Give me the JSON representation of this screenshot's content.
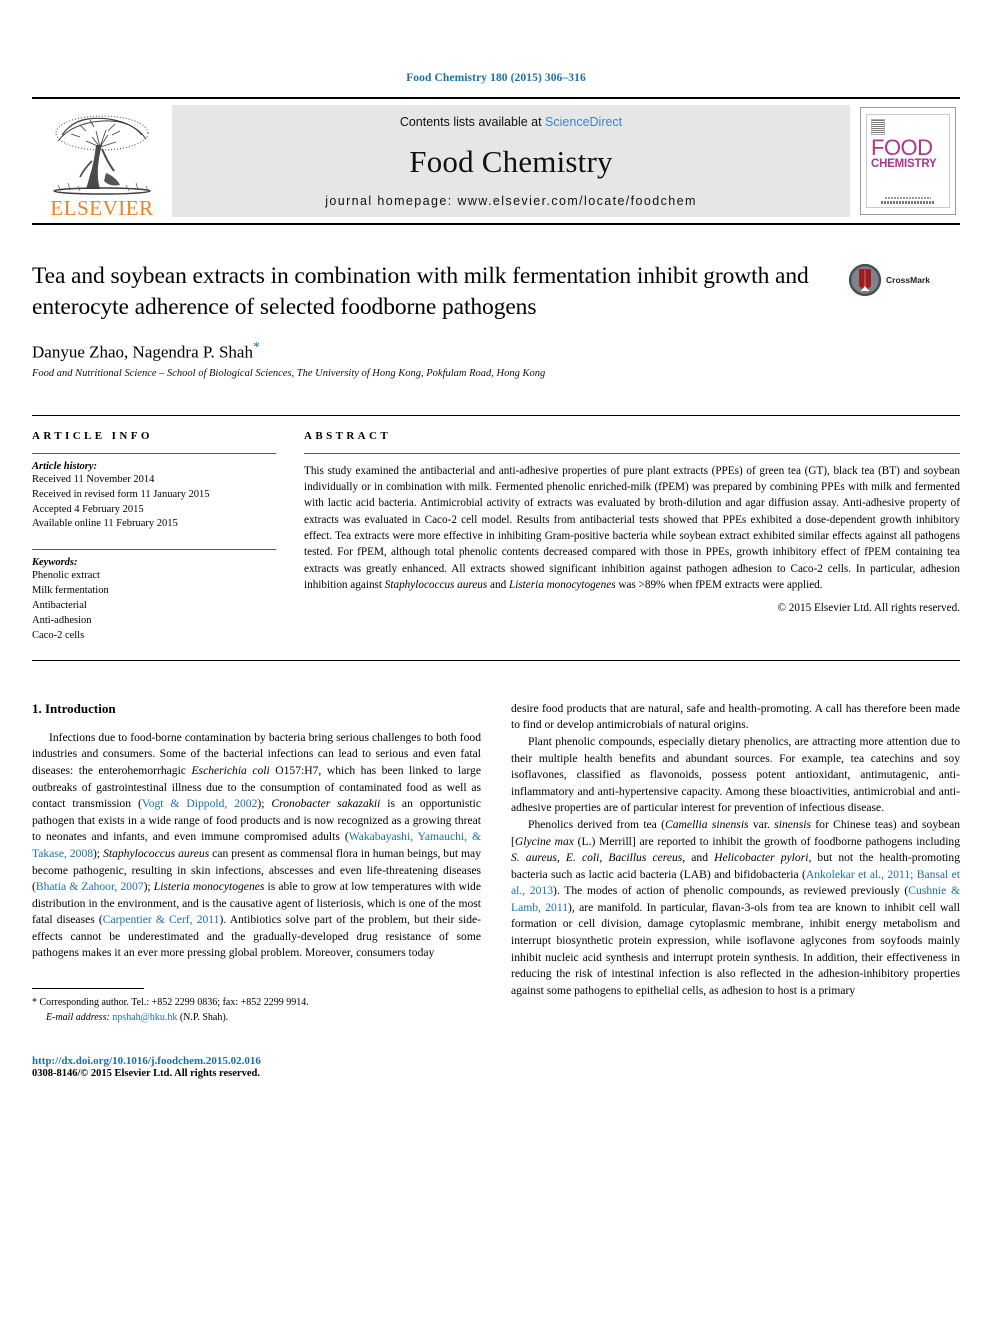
{
  "running_head": "Food Chemistry 180 (2015) 306–316",
  "masthead": {
    "publisher": "ELSEVIER",
    "contents_prefix": "Contents lists available at ",
    "contents_link": "ScienceDirect",
    "journal_name": "Food Chemistry",
    "homepage": "journal homepage: www.elsevier.com/locate/foodchem",
    "cover": {
      "line1": "FOOD",
      "line2": "CHEMISTRY"
    }
  },
  "article": {
    "title": "Tea and soybean extracts in combination with milk fermentation inhibit growth and enterocyte adherence of selected foodborne pathogens",
    "authors": "Danyue Zhao, Nagendra P. Shah",
    "corresponding_marker": "*",
    "affiliation": "Food and Nutritional Science – School of Biological Sciences, The University of Hong Kong, Pokfulam Road, Hong Kong",
    "crossmark_label": "CrossMark"
  },
  "article_info": {
    "heading": "ARTICLE INFO",
    "history_label": "Article history:",
    "history": [
      "Received 11 November 2014",
      "Received in revised form 11 January 2015",
      "Accepted 4 February 2015",
      "Available online 11 February 2015"
    ],
    "keywords_label": "Keywords:",
    "keywords": [
      "Phenolic extract",
      "Milk fermentation",
      "Antibacterial",
      "Anti-adhesion",
      "Caco-2 cells"
    ]
  },
  "abstract": {
    "heading": "ABSTRACT",
    "p1_a": "This study examined the antibacterial and anti-adhesive properties of pure plant extracts (PPEs) of green tea (GT), black tea (BT) and soybean individually or in combination with milk. Fermented phenolic enriched-milk (fPEM) was prepared by combining PPEs with milk and fermented with lactic acid bacteria. Antimicrobial activity of extracts was evaluated by broth-dilution and agar diffusion assay. Anti-adhesive property of extracts was evaluated in Caco-2 cell model. Results from antibacterial tests showed that PPEs exhibited a dose-dependent growth inhibitory effect. Tea extracts were more effective in inhibiting Gram-positive bacteria while soybean extract exhibited similar effects against all pathogens tested. For fPEM, although total phenolic contents decreased compared with those in PPEs, growth inhibitory effect of fPEM containing tea extracts was greatly enhanced. All extracts showed significant inhibition against pathogen adhesion to Caco-2 cells. In particular, adhesion inhibition against ",
    "p1_italic1": "Staphylococcus aureus",
    "p1_b": " and ",
    "p1_italic2": "Listeria monocytogenes",
    "p1_c": " was >89% when fPEM extracts were applied.",
    "copyright": "© 2015 Elsevier Ltd. All rights reserved."
  },
  "body": {
    "section1_heading": "1. Introduction",
    "left": {
      "p1_a": "Infections due to food-borne contamination by bacteria bring serious challenges to both food industries and consumers. Some of the bacterial infections can lead to serious and even fatal diseases: the enterohemorrhagic ",
      "p1_it1": "Escherichia coli",
      "p1_b": " O157:H7, which has been linked to large outbreaks of gastrointestinal illness due to the consumption of contaminated food as well as contact transmission (",
      "p1_ref1": "Vogt & Dippold, 2002",
      "p1_c": "); ",
      "p1_it2": "Cronobacter sakazakii",
      "p1_d": " is an opportunistic pathogen that exists in a wide range of food products and is now recognized as a growing threat to neonates and infants, and even immune compromised adults (",
      "p1_ref2": "Wakabayashi, Yamauchi, & Takase, 2008",
      "p1_e": "); ",
      "p1_it3": "Staphylococcus aureus",
      "p1_f": " can present as commensal flora in human beings, but may become pathogenic, resulting in skin infections, abscesses and even life-threatening diseases (",
      "p1_ref3": "Bhatia & Zahoor, 2007",
      "p1_g": "); ",
      "p1_it4": "Listeria monocytogenes",
      "p1_h": " is able to grow at low temperatures with wide distribution in the environment, and is the causative agent of listeriosis, which is one of the most fatal diseases (",
      "p1_ref4": "Carpentier & Cerf, 2011",
      "p1_i": "). Antibiotics solve part of the problem, but their side-effects cannot be underestimated and the gradually-developed drug resistance of some pathogens makes it an ever more pressing global problem. Moreover, consumers today"
    },
    "right": {
      "p1": "desire food products that are natural, safe and health-promoting. A call has therefore been made to find or develop antimicrobials of natural origins.",
      "p2": "Plant phenolic compounds, especially dietary phenolics, are attracting more attention due to their multiple health benefits and abundant sources. For example, tea catechins and soy isoflavones, classified as flavonoids, possess potent antioxidant, antimutagenic, anti-inflammatory and anti-hypertensive capacity. Among these bioactivities, antimicrobial and anti-adhesive properties are of particular interest for prevention of infectious disease.",
      "p3_a": "Phenolics derived from tea (",
      "p3_it1": "Camellia sinensis",
      "p3_b": " var. ",
      "p3_it2": "sinensis",
      "p3_c": " for Chinese teas) and soybean [",
      "p3_it3": "Glycine max",
      "p3_d": " (L.) Merrill] are reported to inhibit the growth of foodborne pathogens including ",
      "p3_it4": "S. aureus, E. coli, Bacillus cereus,",
      "p3_e": " and ",
      "p3_it5": "Helicobacter pylori",
      "p3_f": ", but not the health-promoting bacteria such as lactic acid bacteria (LAB) and bifidobacteria (",
      "p3_ref1": "Ankolekar et al., 2011; Bansal et al., 2013",
      "p3_g": "). The modes of action of phenolic compounds, as reviewed previously (",
      "p3_ref2": "Cushnie & Lamb, 2011",
      "p3_h": "), are manifold. In particular, flavan-3-ols from tea are known to inhibit cell wall formation or cell division, damage cytoplasmic membrane, inhibit energy metabolism and interrupt biosynthetic protein expression, while isoflavone aglycones from soyfoods mainly inhibit nucleic acid synthesis and interrupt protein synthesis. In addition, their effectiveness in reducing the risk of intestinal infection is also reflected in the adhesion-inhibitory properties against some pathogens to epithelial cells, as adhesion to host is a primary"
    }
  },
  "footnote": {
    "marker": "*",
    "line1": "Corresponding author. Tel.: +852 2299 0836; fax: +852 2299 9914.",
    "email_label": "E-mail address:",
    "email": "npshah@hku.hk",
    "email_suffix": "(N.P. Shah)."
  },
  "footer": {
    "doi": "http://dx.doi.org/10.1016/j.foodchem.2015.02.016",
    "issn": "0308-8146/© 2015 Elsevier Ltd. All rights reserved."
  },
  "colors": {
    "link_blue": "#1a6fa8",
    "elsevier_orange": "#f08020",
    "cover_magenta": "#b0338c"
  }
}
